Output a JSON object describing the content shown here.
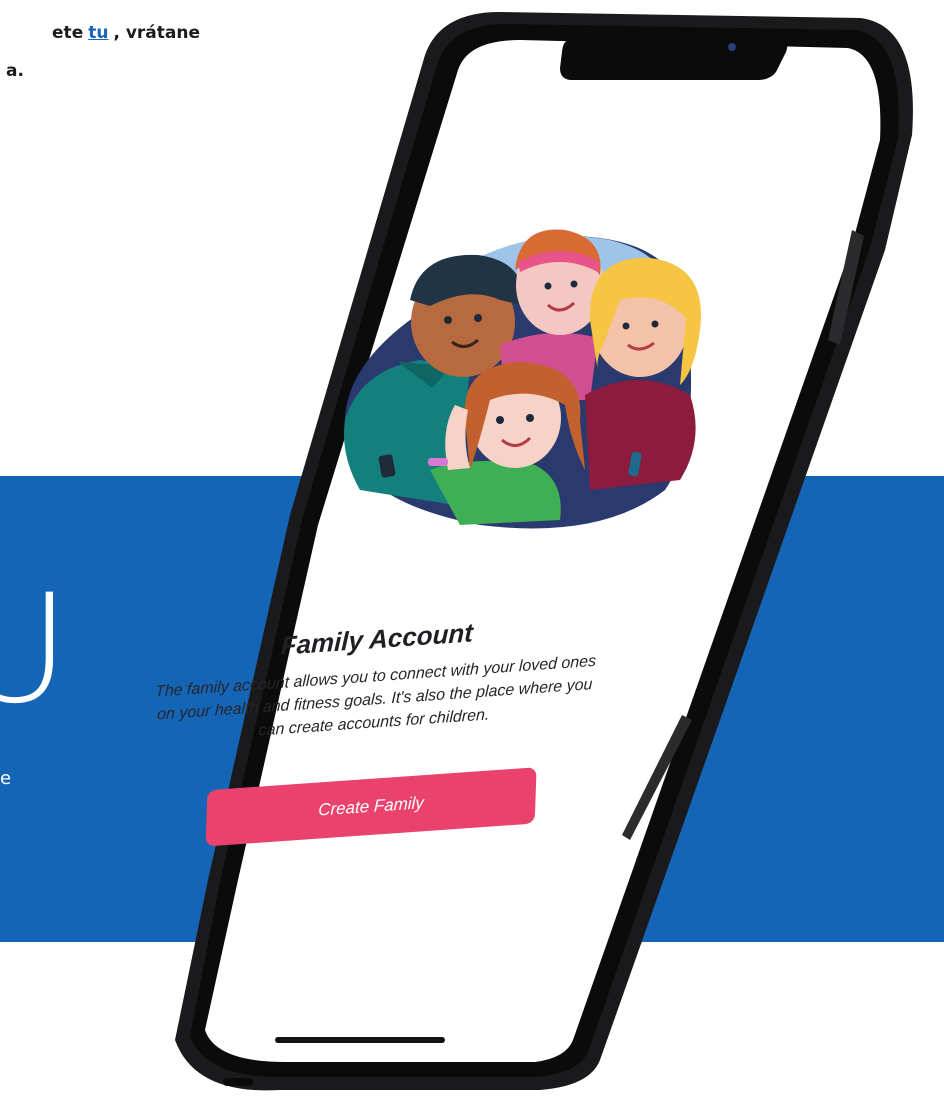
{
  "intro": {
    "line1_before": "ete",
    "line1_link": "tu",
    "line1_after": ", vrátane",
    "line2": "a."
  },
  "banner": {
    "big_letter": "U",
    "small_letter": "e"
  },
  "app_screen": {
    "title": "Family Account",
    "description": "The family account allows you to connect with your loved ones on your health and fitness goals. It's also the place where you can create accounts for children.",
    "button_label": "Create Family"
  },
  "colors": {
    "banner_blue": "#1565b7",
    "button_pink": "#e9426c",
    "phone_frame": "#1a1a1c",
    "link": "#1b63b8"
  },
  "icons": {
    "illustration": "family-illustration",
    "camera": "camera-icon",
    "home_indicator": "home-indicator-bar"
  }
}
